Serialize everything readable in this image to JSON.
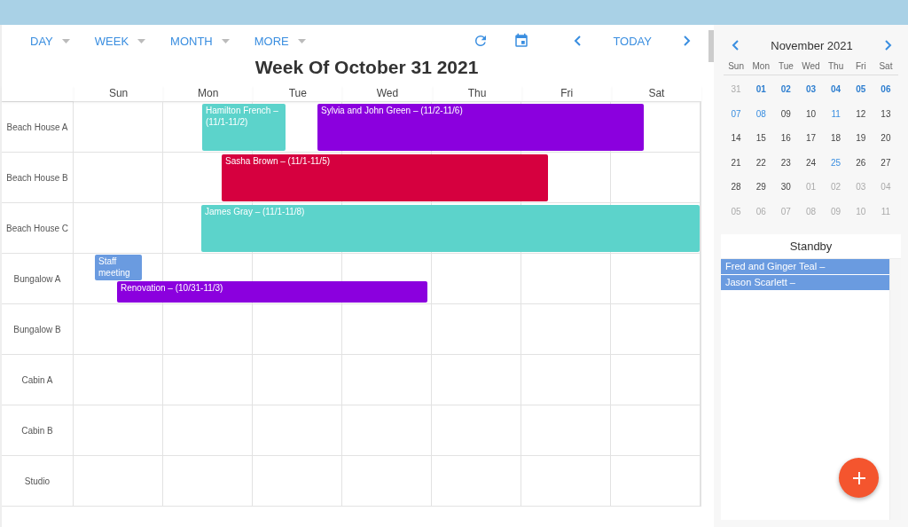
{
  "toolbar": {
    "views": [
      {
        "label": "DAY",
        "selected": false
      },
      {
        "label": "WEEK",
        "selected": false
      },
      {
        "label": "MONTH",
        "selected": false
      },
      {
        "label": "MORE",
        "selected": false
      }
    ],
    "today": "TODAY"
  },
  "title": "Week Of October 31 2021",
  "days": [
    "Sun",
    "Mon",
    "Tue",
    "Wed",
    "Thu",
    "Fri",
    "Sat"
  ],
  "resources": [
    {
      "name": "Beach House A",
      "events": [
        {
          "text": "Hamilton French – (11/1-11/2)",
          "color": "#5cd3cb"
        },
        {
          "text": "Sylvia and John Green – (11/2-11/6)",
          "color": "#8b00de"
        }
      ]
    },
    {
      "name": "Beach House B",
      "events": [
        {
          "text": "Sasha Brown – (11/1-11/5)",
          "color": "#d6003f"
        }
      ]
    },
    {
      "name": "Beach House C",
      "events": [
        {
          "text": "James Gray – (11/1-11/8)",
          "color": "#5cd3cb"
        }
      ]
    },
    {
      "name": "Bungalow A",
      "events": [
        {
          "text": "Staff meeting",
          "color": "#6a9be0"
        },
        {
          "text": "Renovation – (10/31-11/3)",
          "color": "#8b00de"
        }
      ]
    },
    {
      "name": "Bungalow B"
    },
    {
      "name": "Cabin A"
    },
    {
      "name": "Cabin B"
    },
    {
      "name": "Studio"
    }
  ],
  "mini_calendar": {
    "month": "November 2021",
    "weekdays": [
      "Sun",
      "Mon",
      "Tue",
      "Wed",
      "Thu",
      "Fri",
      "Sat"
    ],
    "days": [
      {
        "label": "31",
        "kind": "other"
      },
      {
        "label": "01",
        "kind": "week"
      },
      {
        "label": "02",
        "kind": "week"
      },
      {
        "label": "03",
        "kind": "week"
      },
      {
        "label": "04",
        "kind": "week"
      },
      {
        "label": "05",
        "kind": "week"
      },
      {
        "label": "06",
        "kind": "week"
      },
      {
        "label": "07",
        "kind": "marked"
      },
      {
        "label": "08",
        "kind": "marked"
      },
      {
        "label": "09",
        "kind": "normal"
      },
      {
        "label": "10",
        "kind": "normal"
      },
      {
        "label": "11",
        "kind": "marked"
      },
      {
        "label": "12",
        "kind": "normal"
      },
      {
        "label": "13",
        "kind": "normal"
      },
      {
        "label": "14",
        "kind": "normal"
      },
      {
        "label": "15",
        "kind": "normal"
      },
      {
        "label": "16",
        "kind": "normal"
      },
      {
        "label": "17",
        "kind": "normal"
      },
      {
        "label": "18",
        "kind": "normal"
      },
      {
        "label": "19",
        "kind": "normal"
      },
      {
        "label": "20",
        "kind": "normal"
      },
      {
        "label": "21",
        "kind": "normal"
      },
      {
        "label": "22",
        "kind": "normal"
      },
      {
        "label": "23",
        "kind": "normal"
      },
      {
        "label": "24",
        "kind": "normal"
      },
      {
        "label": "25",
        "kind": "marked"
      },
      {
        "label": "26",
        "kind": "normal"
      },
      {
        "label": "27",
        "kind": "normal"
      },
      {
        "label": "28",
        "kind": "normal"
      },
      {
        "label": "29",
        "kind": "normal"
      },
      {
        "label": "30",
        "kind": "normal"
      },
      {
        "label": "01",
        "kind": "other"
      },
      {
        "label": "02",
        "kind": "other"
      },
      {
        "label": "03",
        "kind": "other"
      },
      {
        "label": "04",
        "kind": "other"
      },
      {
        "label": "05",
        "kind": "other"
      },
      {
        "label": "06",
        "kind": "other"
      },
      {
        "label": "07",
        "kind": "other"
      },
      {
        "label": "08",
        "kind": "other"
      },
      {
        "label": "09",
        "kind": "other"
      },
      {
        "label": "10",
        "kind": "other"
      },
      {
        "label": "11",
        "kind": "other"
      }
    ]
  },
  "standby": {
    "title": "Standby",
    "items": [
      {
        "text": "Fred and Ginger Teal –"
      },
      {
        "text": "Jason Scarlett –"
      }
    ]
  }
}
